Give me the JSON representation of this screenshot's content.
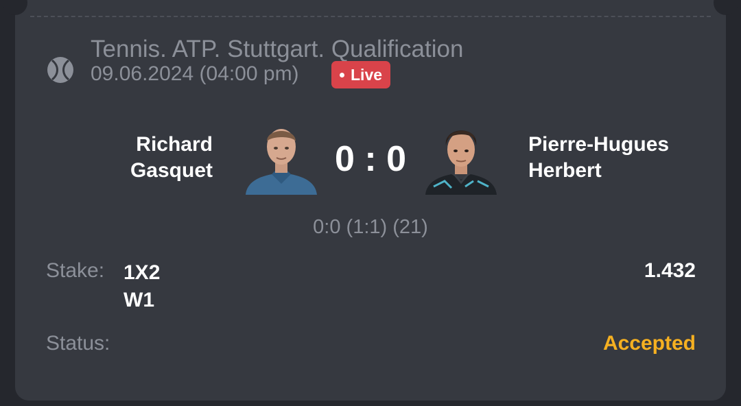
{
  "event": {
    "sport_icon": "tennis-ball-icon",
    "tournament": "Tennis. ATP. Stuttgart. Qualification",
    "date": "09.06.2024 (04:00 pm)",
    "live_label": "Live"
  },
  "match": {
    "team1": {
      "line1": "Richard",
      "line2": "Gasquet"
    },
    "team2": {
      "line1": "Pierre-Hugues",
      "line2": "Herbert"
    },
    "score": "0 : 0",
    "detail_score": "0:0 (1:1) (21)"
  },
  "bet": {
    "stake_label": "Stake:",
    "market": "1X2",
    "selection": "W1",
    "odds": "1.432",
    "status_label": "Status:",
    "status_value": "Accepted"
  },
  "colors": {
    "background": "#25272d",
    "card": "#363940",
    "muted_text": "#8c9099",
    "live_badge": "#d9434a",
    "accepted": "#f5b021"
  }
}
